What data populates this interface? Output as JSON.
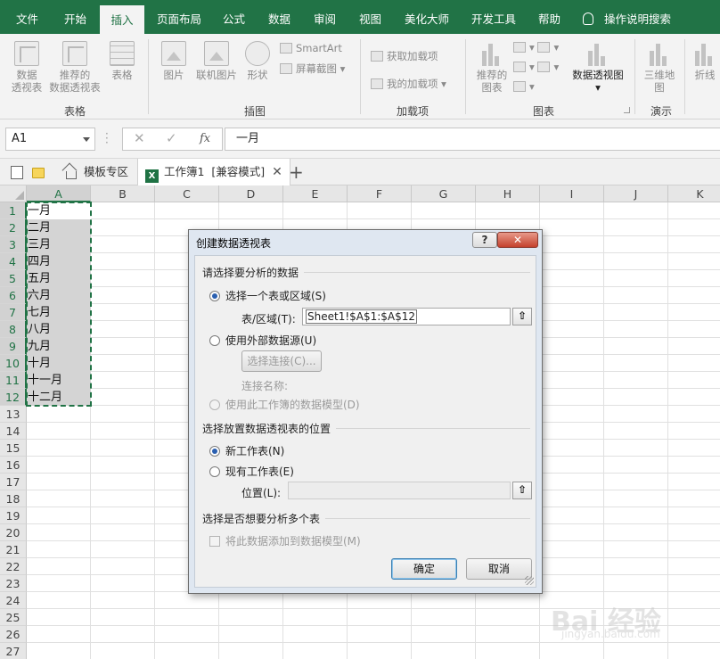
{
  "ribbon_tabs": [
    "文件",
    "开始",
    "插入",
    "页面布局",
    "公式",
    "数据",
    "审阅",
    "视图",
    "美化大师",
    "开发工具",
    "帮助"
  ],
  "tell_me": "操作说明搜索",
  "ribbon": {
    "pivot_table": "数据\n透视表",
    "recommended_pivot": "推荐的\n数据透视表",
    "table": "表格",
    "picture": "图片",
    "online_picture": "联机图片",
    "shapes": "形状",
    "smartart": "SmartArt",
    "screenshot": "屏幕截图",
    "get_addins": "获取加载项",
    "my_addins": "我的加载项",
    "recommended_charts": "推荐的\n图表",
    "pivot_chart": "数据透视图",
    "map_3d": "三维地\n图",
    "line": "折线",
    "groups": [
      "表格",
      "插图",
      "加载项",
      "图表",
      "演示"
    ]
  },
  "formula_bar": {
    "name_box": "A1",
    "cancel": "✕",
    "enter": "✓",
    "fx": "fx",
    "formula": "一月"
  },
  "doc_tabs": {
    "template_tab": "模板专区",
    "workbook_tab": "工作簿1  [兼容模式]"
  },
  "sheet": {
    "columns": [
      "A",
      "B",
      "C",
      "D",
      "E",
      "F",
      "G",
      "H",
      "I",
      "J",
      "K"
    ],
    "rows": [
      "1",
      "2",
      "3",
      "4",
      "5",
      "6",
      "7",
      "8",
      "9",
      "10",
      "11",
      "12",
      "13",
      "14",
      "15",
      "16",
      "17",
      "18",
      "19",
      "20",
      "21",
      "22",
      "23",
      "24",
      "25",
      "26",
      "27"
    ],
    "col_a_values": [
      "一月",
      "二月",
      "三月",
      "四月",
      "五月",
      "六月",
      "七月",
      "八月",
      "九月",
      "十月",
      "十一月",
      "十二月"
    ]
  },
  "dialog": {
    "title": "创建数据透视表",
    "help": "?",
    "close": "✕",
    "section1": "请选择要分析的数据",
    "opt_select_range": "选择一个表或区域(S)",
    "range_label": "表/区域(T):",
    "range_value": "Sheet1!$A$1:$A$12",
    "opt_external": "使用外部数据源(U)",
    "choose_connection": "选择连接(C)...",
    "connection_name": "连接名称:",
    "opt_data_model": "使用此工作簿的数据模型(D)",
    "section2": "选择放置数据透视表的位置",
    "opt_new_sheet": "新工作表(N)",
    "opt_existing_sheet": "现有工作表(E)",
    "location_label": "位置(L):",
    "location_value": "",
    "section3": "选择是否想要分析多个表",
    "add_to_model": "将此数据添加到数据模型(M)",
    "ok": "确定",
    "cancel": "取消",
    "collapse_icon": "⇧"
  },
  "watermark": {
    "text": "Bai 经验",
    "url": "jingyan.baidu.com"
  }
}
